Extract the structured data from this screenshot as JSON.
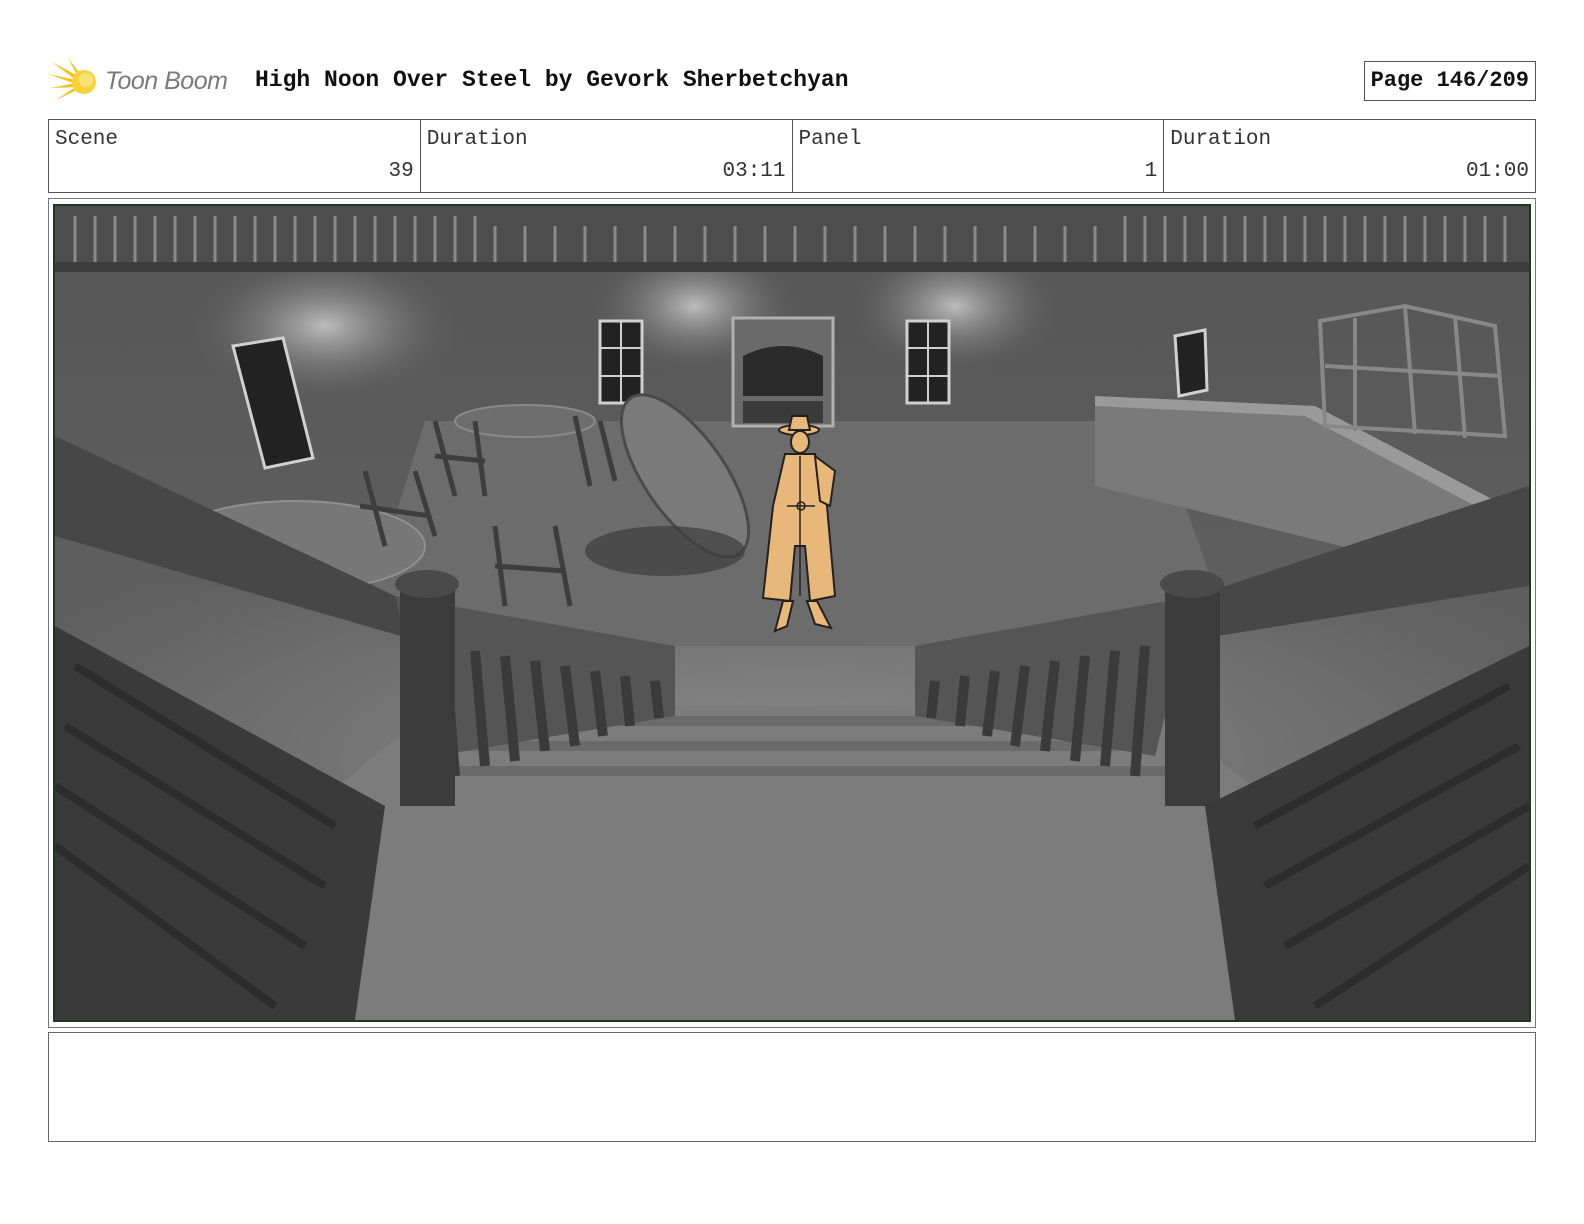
{
  "header": {
    "logo_text": "Toon Boom",
    "title": "High Noon Over Steel by Gevork Sherbetchyan",
    "page": "Page 146/209"
  },
  "info": [
    {
      "label": "Scene",
      "value": "39"
    },
    {
      "label": "Duration",
      "value": "03:11"
    },
    {
      "label": "Panel",
      "value": "1"
    },
    {
      "label": "Duration",
      "value": "01:00"
    }
  ],
  "panel": {
    "frame_color": "#1e3a1e",
    "character_color": "#e8b87a"
  },
  "notes": ""
}
